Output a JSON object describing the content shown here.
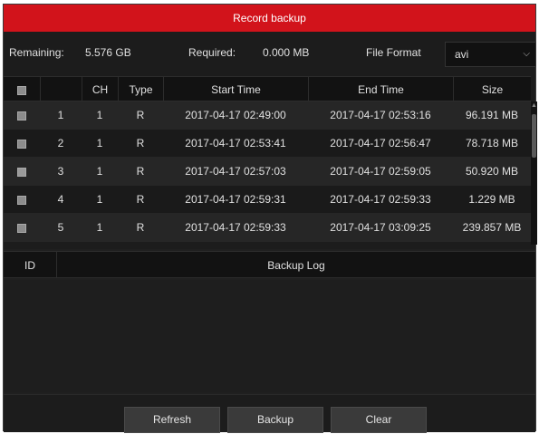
{
  "title": "Record backup",
  "info": {
    "remaining_label": "Remaining:",
    "remaining_value": "5.576 GB",
    "required_label": "Required:",
    "required_value": "0.000 MB",
    "format_label": "File Format",
    "format_value": "avi"
  },
  "table": {
    "headers": {
      "ch": "CH",
      "type": "Type",
      "start": "Start Time",
      "end": "End Time",
      "size": "Size"
    },
    "rows": [
      {
        "id": "1",
        "ch": "1",
        "type": "R",
        "start": "2017-04-17 02:49:00",
        "end": "2017-04-17 02:53:16",
        "size": "96.191 MB",
        "checked": false
      },
      {
        "id": "2",
        "ch": "1",
        "type": "R",
        "start": "2017-04-17 02:53:41",
        "end": "2017-04-17 02:56:47",
        "size": "78.718 MB",
        "checked": false
      },
      {
        "id": "3",
        "ch": "1",
        "type": "R",
        "start": "2017-04-17 02:57:03",
        "end": "2017-04-17 02:59:05",
        "size": "50.920 MB",
        "checked": true
      },
      {
        "id": "4",
        "ch": "1",
        "type": "R",
        "start": "2017-04-17 02:59:31",
        "end": "2017-04-17 02:59:33",
        "size": "1.229 MB",
        "checked": false
      },
      {
        "id": "5",
        "ch": "1",
        "type": "R",
        "start": "2017-04-17 02:59:33",
        "end": "2017-04-17 03:09:25",
        "size": "239.857 MB",
        "checked": false
      }
    ]
  },
  "log": {
    "id_header": "ID",
    "log_header": "Backup Log"
  },
  "buttons": {
    "refresh": "Refresh",
    "backup": "Backup",
    "clear": "Clear"
  },
  "colors": {
    "titlebar": "#d2131b",
    "background": "#1c1c1c",
    "header": "#121212"
  }
}
